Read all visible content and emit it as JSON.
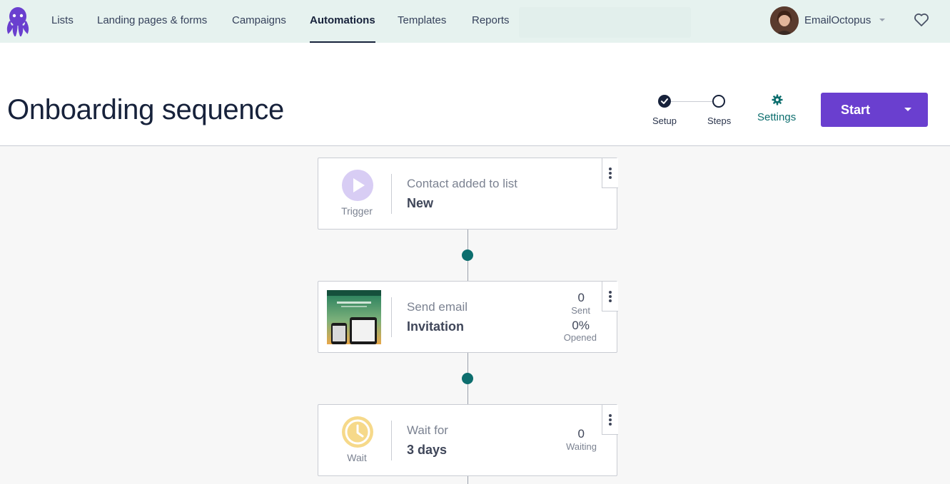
{
  "nav": {
    "items": [
      {
        "label": "Lists"
      },
      {
        "label": "Landing pages & forms"
      },
      {
        "label": "Campaigns"
      },
      {
        "label": "Automations"
      },
      {
        "label": "Templates"
      },
      {
        "label": "Reports"
      }
    ],
    "active": "Automations",
    "account_name": "EmailOctopus"
  },
  "header": {
    "title": "Onboarding sequence",
    "steps": [
      {
        "label": "Setup",
        "status": "done"
      },
      {
        "label": "Steps",
        "status": "current"
      }
    ],
    "settings_label": "Settings",
    "start_label": "Start"
  },
  "flow": {
    "trigger": {
      "icon_label": "Trigger",
      "type": "Contact added to list",
      "value": "New"
    },
    "email": {
      "type": "Send email",
      "value": "Invitation",
      "sent": "0",
      "sent_label": "Sent",
      "opened": "0%",
      "opened_label": "Opened"
    },
    "wait": {
      "icon_label": "Wait",
      "type": "Wait for",
      "value": "3 days",
      "waiting": "0",
      "waiting_label": "Waiting"
    }
  },
  "colors": {
    "brand_purple": "#6a3fcf",
    "accent_teal": "#0d6e6e",
    "nav_bg": "#e6f2ef",
    "trigger_icon": "#d8cdf4",
    "wait_icon": "#f6d98a"
  }
}
